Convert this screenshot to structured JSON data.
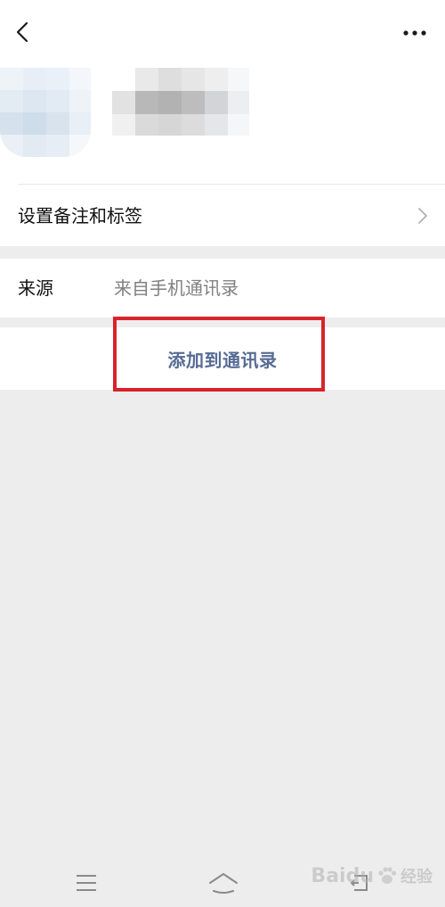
{
  "header": {
    "back_icon": "chevron-left-icon",
    "more_icon": "more-dots-icon"
  },
  "profile": {
    "avatar_colors": [
      "#eef3f8",
      "#e7eef6",
      "#eaf0f7",
      "#f3f6fa",
      "#e3ebf3",
      "#dde7f1",
      "#e2eaf3",
      "#eef3f8",
      "#d5e1ec",
      "#cfdce9",
      "#d8e3ee",
      "#e9eff6",
      "#eaf0f6",
      "#e2eaf2",
      "#e6edf5",
      "#f5f7fa"
    ],
    "nickname_colors": [
      "#ffffff",
      "#e9e9e9",
      "#dedede",
      "#e6e6e6",
      "#eeeeee",
      "#f6f7f9",
      "#e2e2e2",
      "#b8b8b8",
      "#b2b2b2",
      "#bdbdbd",
      "#d2d4d8",
      "#eceef2",
      "#f0f0f0",
      "#dadada",
      "#d6d6d6",
      "#dcdcdc",
      "#e4e6ea",
      "#f5f6f8"
    ]
  },
  "remark": {
    "label": "设置备注和标签",
    "chevron_icon": "chevron-right-icon"
  },
  "source": {
    "label": "来源",
    "value": "来自手机通讯录"
  },
  "add_contact": {
    "label": "添加到通讯录",
    "highlight_color": "#d8232a",
    "text_color": "#576b95"
  },
  "navbar": {
    "menu_icon": "menu-icon",
    "home_icon": "home-icon",
    "back_icon": "back-icon"
  },
  "watermark": {
    "brand": "Baidu",
    "suffix": "经验"
  }
}
